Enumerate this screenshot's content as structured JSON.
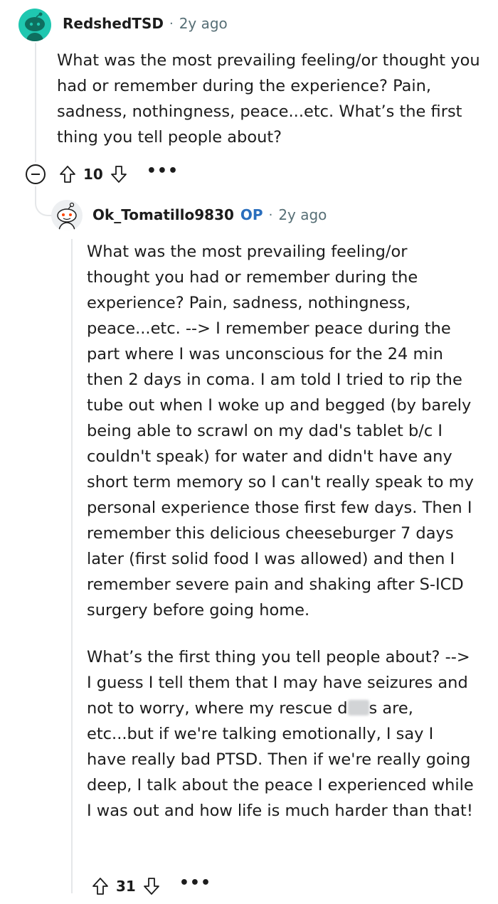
{
  "comments": [
    {
      "username": "RedshedTSD",
      "separator": "·",
      "time": "2y ago",
      "body": "What was the most prevailing feeling/or thought you had or remember during the experience? Pain, sadness, nothingness, peace...etc. What’s the first thing you tell people about?",
      "score": "10",
      "more": "•••"
    },
    {
      "username": "Ok_Tomatillo9830",
      "op_badge": "OP",
      "separator": "·",
      "time": "2y ago",
      "paragraph_1": "What was the most prevailing feeling/or thought you had or remember during the experience? Pain, sadness, nothingness, peace...etc. --> I remember peace during the part where I was unconscious for the 24 min then 2 days in coma. I am told I tried to rip the tube out when I woke up and begged (by barely being able to scrawl on my dad's tablet b/c I couldn't speak) for water and didn't have any short term memory so I can't really speak to my personal experience those first few days. Then I remember this delicious cheeseburger 7 days later (first solid food I was allowed) and then I remember severe pain and shaking after S-ICD surgery before going home.",
      "paragraph_2_before": "What’s the first thing you tell people about? --> I guess I tell them that I may have seizures and not to worry, where my rescue d",
      "paragraph_2_after": "s are, etc...but if we're talking emotionally, I say I have really bad PTSD. Then if we're really going deep, I talk about the peace I experienced while I was out and how life is much harder than that!",
      "score": "31",
      "more": "•••"
    }
  ],
  "icons": {
    "avatar_1": "snoo-avatar-teal",
    "avatar_2": "snoo-avatar-white",
    "collapse": "collapse-minus-icon",
    "upvote": "arrow-up-icon",
    "downvote": "arrow-down-icon",
    "more": "more-dots-icon"
  },
  "colors": {
    "avatar_teal": "#1fc7b0",
    "op_blue": "#2a6ebd",
    "meta_gray": "#576f76",
    "thread_line": "#e5e7e9"
  }
}
